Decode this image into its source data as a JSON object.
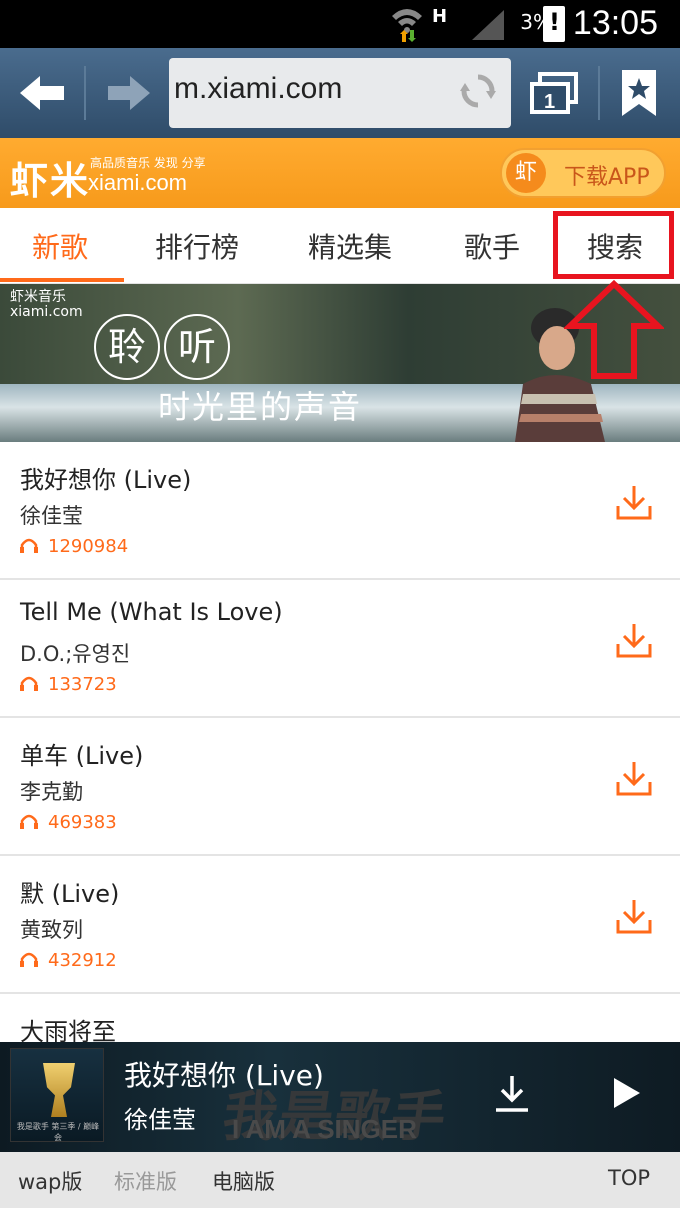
{
  "status": {
    "network": "H",
    "battery": "3%",
    "time": "13:05"
  },
  "browser": {
    "url": "m.xiami.com",
    "tab_count": "1"
  },
  "brand": {
    "logo_cn": "虾米",
    "logo_tagline": "高品质音乐 发现 分享",
    "logo_domain": "xiami.com",
    "download_icon_char": "虾",
    "download_app": "下载APP"
  },
  "tabs": [
    {
      "label": "新歌"
    },
    {
      "label": "排行榜"
    },
    {
      "label": "精选集"
    },
    {
      "label": "歌手"
    },
    {
      "label": "搜索"
    }
  ],
  "banner": {
    "brand_cn": "虾米音乐",
    "brand_en": "xiami.com",
    "char1": "聆",
    "char2": "听",
    "subtitle": "时光里的声音"
  },
  "songs": [
    {
      "title": "我好想你 (Live)",
      "artist": "徐佳莹",
      "plays": "1290984"
    },
    {
      "title": "Tell Me (What Is Love)",
      "artist": "D.O.;유영진",
      "plays": "133723"
    },
    {
      "title": "单车 (Live)",
      "artist": "李克勤",
      "plays": "469383"
    },
    {
      "title": "默 (Live)",
      "artist": "黄致列",
      "plays": "432912"
    },
    {
      "title": "大雨将至"
    }
  ],
  "player": {
    "title": "我好想你 (Live)",
    "artist": "徐佳莹",
    "bg_text": "我是歌手",
    "bg_text_en": "I AM A SINGER",
    "cover_caption": "我是歌手 第三季 / 巅峰会"
  },
  "footer": {
    "wap": "wap版",
    "standard": "标准版",
    "desktop": "电脑版",
    "top": "TOP"
  },
  "colors": {
    "accent": "#ff6a1a",
    "brand_orange": "#ffa425",
    "browser_bar": "#3c5a7a",
    "highlight_red": "#e8141f"
  }
}
